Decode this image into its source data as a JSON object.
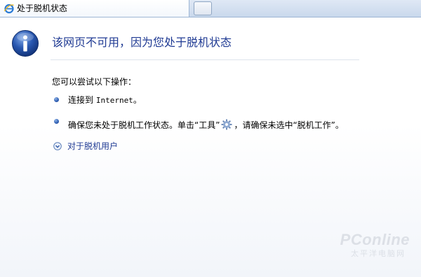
{
  "tab": {
    "title": "处于脱机状态",
    "icon": "internet-explorer-icon"
  },
  "page": {
    "heading": "该网页不可用，因为您处于脱机状态",
    "suggestions_heading": "您可以尝试以下操作：",
    "suggestions": [
      {
        "prefix": "连接到 ",
        "mono": "Internet",
        "suffix": "。"
      },
      {
        "prefix": "确保您未处于脱机工作状态。单击“工具”",
        "suffix": "，请确保未选中“脱机工作”。"
      }
    ],
    "more_info_link": "对于脱机用户"
  },
  "watermark": {
    "brand": "PConline",
    "subtitle": "太平洋电脑网"
  },
  "colors": {
    "heading": "#1f3a93",
    "link": "#1f3a93",
    "tabbar": "#d5e1f1",
    "info_icon": "#1e4fa1"
  }
}
